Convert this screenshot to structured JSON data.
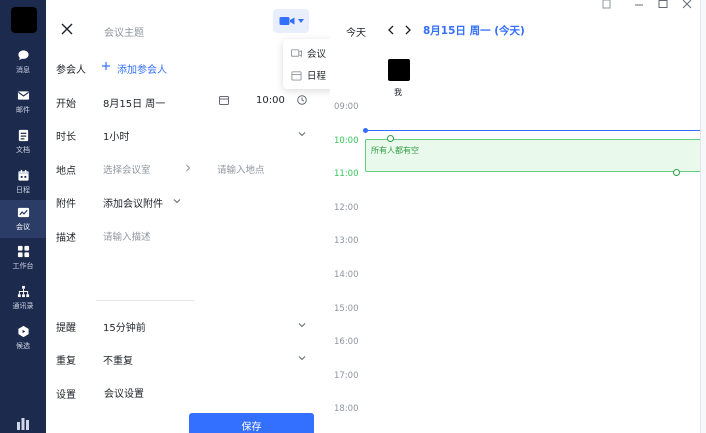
{
  "rail": {
    "items": [
      {
        "label": "消息",
        "icon": "chat-icon"
      },
      {
        "label": "邮件",
        "icon": "mail-icon"
      },
      {
        "label": "文档",
        "icon": "docs-icon"
      },
      {
        "label": "日程",
        "icon": "calendar-icon"
      },
      {
        "label": "会议",
        "icon": "meeting-icon"
      },
      {
        "label": "工作台",
        "icon": "workplace-icon"
      },
      {
        "label": "通讯录",
        "icon": "contacts-icon"
      },
      {
        "label": "候选",
        "icon": "candidate-icon"
      }
    ],
    "active_index": 4
  },
  "form": {
    "topic_placeholder": "会议主题",
    "type_menu": {
      "items": [
        {
          "label": "会议",
          "icon": "video-meeting-icon"
        },
        {
          "label": "日程",
          "icon": "calendar-icon"
        }
      ]
    },
    "participants": {
      "label": "参会人",
      "action": "添加参会人",
      "icon": "plus-icon"
    },
    "start": {
      "label": "开始",
      "date": "8月15日 周一",
      "time": "10:00"
    },
    "duration": {
      "label": "时长",
      "value": "1小时"
    },
    "location": {
      "label": "地点",
      "room_placeholder": "选择会议室",
      "address_placeholder": "请输入地点"
    },
    "attachment": {
      "label": "附件",
      "action": "添加会议附件"
    },
    "description": {
      "label": "描述",
      "placeholder": "请输入描述"
    },
    "reminder": {
      "label": "提醒",
      "value": "15分钟前"
    },
    "repeat": {
      "label": "重复",
      "value": "不重复"
    },
    "settings": {
      "label": "设置",
      "value": "会议设置"
    },
    "save_label": "保存"
  },
  "calendar": {
    "today_label": "今天",
    "date_label": "8月15日 周一 (今天)",
    "attendee_label": "我",
    "hours": [
      "09:00",
      "10:00",
      "11:00",
      "12:00",
      "13:00",
      "14:00",
      "15:00",
      "16:00",
      "17:00",
      "18:00"
    ],
    "highlighted_hours": [
      "10:00",
      "11:00"
    ],
    "slot_text": "所有人都有空"
  },
  "colors": {
    "accent": "#3370ff",
    "rail_bg": "#1c2a4d",
    "free_green": "#34c759"
  }
}
